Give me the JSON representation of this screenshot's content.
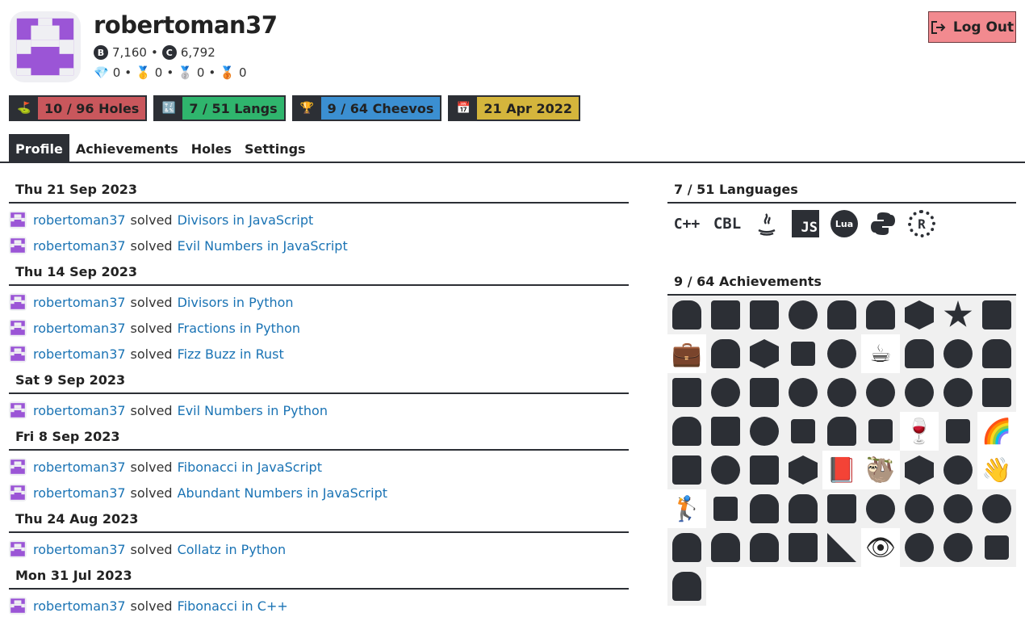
{
  "profile": {
    "username": "robertoman37",
    "bytes_label": "B",
    "bytes": "7,160",
    "chars_label": "C",
    "chars": "6,792",
    "sep": "•",
    "medals": [
      {
        "icon": "💎",
        "name": "diamond-medal-icon",
        "count": "0"
      },
      {
        "icon": "🥇",
        "name": "gold-medal-icon",
        "count": "0"
      },
      {
        "icon": "🥈",
        "name": "silver-medal-icon",
        "count": "0"
      },
      {
        "icon": "🥉",
        "name": "bronze-medal-icon",
        "count": "0"
      }
    ],
    "logout_label": "Log Out"
  },
  "badges": [
    {
      "icon": "⛳",
      "icon_name": "golf-flag-icon",
      "text": "10 / 96 Holes",
      "color": "#c9575c"
    },
    {
      "icon": "🔣",
      "icon_name": "symbols-icon",
      "text": "7 / 51 Langs",
      "color": "#2fb56d"
    },
    {
      "icon": "🏆",
      "icon_name": "trophy-icon",
      "text": "9 / 64 Cheevos",
      "color": "#3b8fd1"
    },
    {
      "icon": "📅",
      "icon_name": "calendar-icon",
      "text": "21 Apr 2022",
      "color": "#d4b53c"
    }
  ],
  "tabs": [
    "Profile",
    "Achievements",
    "Holes",
    "Settings"
  ],
  "feed": [
    {
      "date": "Thu 21 Sep 2023",
      "items": [
        {
          "user": "robertoman37",
          "verb": "solved",
          "hole": "Divisors in JavaScript"
        },
        {
          "user": "robertoman37",
          "verb": "solved",
          "hole": "Evil Numbers in JavaScript"
        }
      ]
    },
    {
      "date": "Thu 14 Sep 2023",
      "items": [
        {
          "user": "robertoman37",
          "verb": "solved",
          "hole": "Divisors in Python"
        },
        {
          "user": "robertoman37",
          "verb": "solved",
          "hole": "Fractions in Python"
        },
        {
          "user": "robertoman37",
          "verb": "solved",
          "hole": "Fizz Buzz in Rust"
        }
      ]
    },
    {
      "date": "Sat 9 Sep 2023",
      "items": [
        {
          "user": "robertoman37",
          "verb": "solved",
          "hole": "Evil Numbers in Python"
        }
      ]
    },
    {
      "date": "Fri 8 Sep 2023",
      "items": [
        {
          "user": "robertoman37",
          "verb": "solved",
          "hole": "Fibonacci in JavaScript"
        },
        {
          "user": "robertoman37",
          "verb": "solved",
          "hole": "Abundant Numbers in JavaScript"
        }
      ]
    },
    {
      "date": "Thu 24 Aug 2023",
      "items": [
        {
          "user": "robertoman37",
          "verb": "solved",
          "hole": "Collatz in Python"
        }
      ]
    },
    {
      "date": "Mon 31 Jul 2023",
      "items": [
        {
          "user": "robertoman37",
          "verb": "solved",
          "hole": "Fibonacci in C++"
        }
      ]
    }
  ],
  "languages": {
    "heading": "7 / 51 Languages",
    "items": [
      {
        "name": "cpp-logo-icon",
        "text": "C++"
      },
      {
        "name": "cobol-logo-icon",
        "text": "CBL"
      },
      {
        "name": "java-logo-icon",
        "text": ""
      },
      {
        "name": "javascript-logo-icon",
        "text": "JS"
      },
      {
        "name": "lua-logo-icon",
        "text": "Lua"
      },
      {
        "name": "python-logo-icon",
        "text": ""
      },
      {
        "name": "rust-logo-icon",
        "text": "R"
      }
    ]
  },
  "achievements": {
    "heading": "9 / 64 Achievements",
    "cells": [
      {
        "name": "cake-icon",
        "shape": "b"
      },
      {
        "name": "flag-icon",
        "shape": ""
      },
      {
        "name": "square-icon",
        "shape": ""
      },
      {
        "name": "pie-icon",
        "shape": "c"
      },
      {
        "name": "bust-icon",
        "shape": "b"
      },
      {
        "name": "bust-icon-2",
        "shape": "b"
      },
      {
        "name": "hexagon-icon",
        "shape": "d"
      },
      {
        "name": "star-icon",
        "shape": "s"
      },
      {
        "name": "square-icon-2",
        "shape": ""
      },
      {
        "name": "briefcase-icon",
        "emoji": "💼"
      },
      {
        "name": "thinker-icon",
        "shape": "b"
      },
      {
        "name": "books-icon",
        "shape": "d"
      },
      {
        "name": "screwdriver-icon",
        "shape": "sm"
      },
      {
        "name": "bird-icon",
        "shape": "c"
      },
      {
        "name": "coffee-icon",
        "emoji": "☕"
      },
      {
        "name": "bowling-icon",
        "shape": "b"
      },
      {
        "name": "lips-icon",
        "shape": "c"
      },
      {
        "name": "elephant-icon",
        "shape": "b"
      },
      {
        "name": "clipboard-icon",
        "shape": ""
      },
      {
        "name": "fish-icon",
        "shape": "c"
      },
      {
        "name": "square-icon-3",
        "shape": ""
      },
      {
        "name": "clover-icon",
        "shape": "c"
      },
      {
        "name": "apple-icon",
        "shape": "c"
      },
      {
        "name": "brain-icon",
        "shape": "c"
      },
      {
        "name": "ring-icon",
        "shape": "c"
      },
      {
        "name": "bubble-icon",
        "shape": "c"
      },
      {
        "name": "square-icon-4",
        "shape": ""
      },
      {
        "name": "duck-icon",
        "shape": "b"
      },
      {
        "name": "square-icon-5",
        "shape": ""
      },
      {
        "name": "mirror-icon",
        "shape": "c"
      },
      {
        "name": "trumpet-icon",
        "shape": "sm"
      },
      {
        "name": "camel-icon",
        "shape": "b"
      },
      {
        "name": "clamp-icon",
        "shape": "sm"
      },
      {
        "name": "wine-icon",
        "emoji": "🍷"
      },
      {
        "name": "syringe-icon",
        "shape": "sm"
      },
      {
        "name": "rainbow-icon",
        "emoji": "🌈"
      },
      {
        "name": "square-icon-6",
        "shape": ""
      },
      {
        "name": "drumstick-icon",
        "shape": "c"
      },
      {
        "name": "square-icon-7",
        "shape": ""
      },
      {
        "name": "butterfly-icon",
        "shape": "d"
      },
      {
        "name": "red-book-icon",
        "emoji": "📕"
      },
      {
        "name": "sloth-icon",
        "emoji": "🦥"
      },
      {
        "name": "shield-icon",
        "shape": "d"
      },
      {
        "name": "rope-icon",
        "shape": "c"
      },
      {
        "name": "waving-hand-icon",
        "emoji": "👋"
      },
      {
        "name": "golfer-icon",
        "emoji": "🏌"
      },
      {
        "name": "guitar-icon",
        "shape": "sm"
      },
      {
        "name": "bread-icon",
        "shape": "b"
      },
      {
        "name": "mug-icon",
        "shape": "b"
      },
      {
        "name": "square-icon-8",
        "shape": ""
      },
      {
        "name": "circle-icon",
        "shape": "c"
      },
      {
        "name": "bomb-icon",
        "shape": "c"
      },
      {
        "name": "thumbs-up-icon",
        "shape": "c"
      },
      {
        "name": "bomb-icon-2",
        "shape": "c"
      },
      {
        "name": "car-icon",
        "shape": "b"
      },
      {
        "name": "ogre-icon",
        "shape": "b"
      },
      {
        "name": "ship-icon",
        "shape": "b"
      },
      {
        "name": "computer-icon",
        "shape": ""
      },
      {
        "name": "set-square-icon",
        "shape": "t"
      },
      {
        "name": "eye-icon",
        "emoji": "👁"
      },
      {
        "name": "dragon-icon",
        "shape": "c"
      },
      {
        "name": "whale-icon",
        "shape": "c"
      },
      {
        "name": "runner-icon",
        "shape": "sm"
      },
      {
        "name": "tombstone-icon",
        "shape": "b"
      }
    ]
  }
}
